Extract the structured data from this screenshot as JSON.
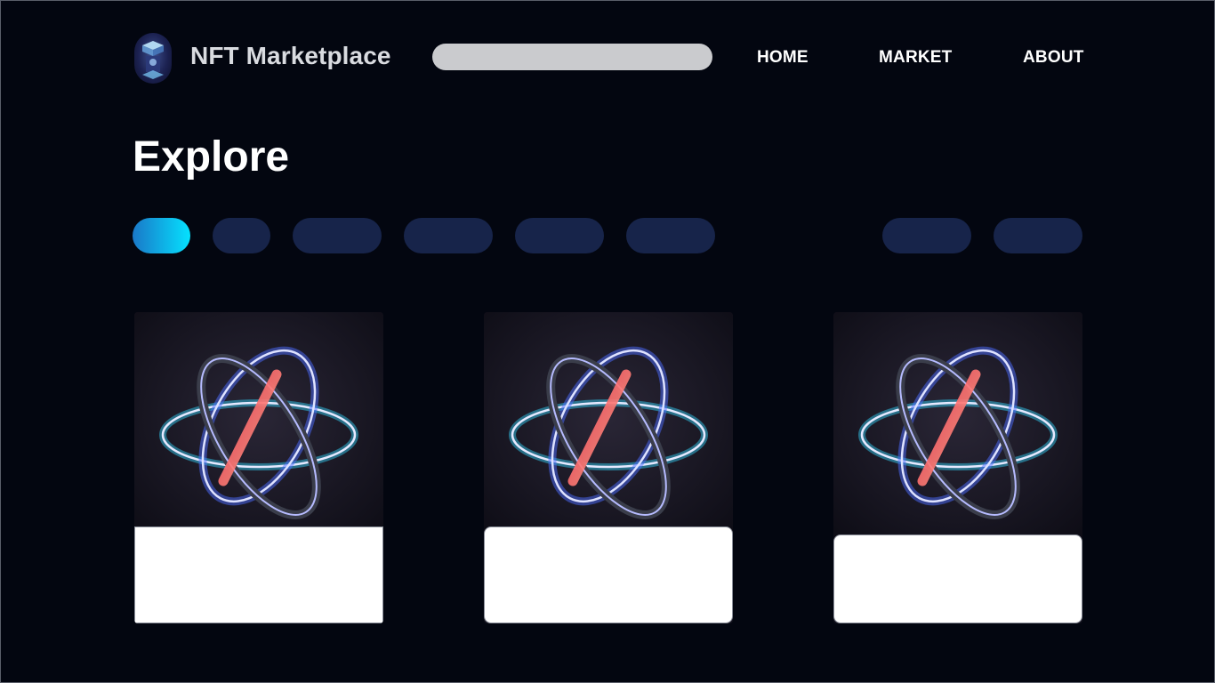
{
  "header": {
    "brand": "NFT Marketplace",
    "logo_icon": "holographic-cube-icon",
    "search": {
      "value": "",
      "placeholder": ""
    },
    "nav": [
      {
        "label": "HOME"
      },
      {
        "label": "MARKET"
      },
      {
        "label": "ABOUT"
      }
    ]
  },
  "main": {
    "title": "Explore",
    "filter_pills": [
      {
        "label": "",
        "active": true,
        "color": "#05e2ff"
      },
      {
        "label": "",
        "active": false
      },
      {
        "label": "",
        "active": false
      },
      {
        "label": "",
        "active": false
      },
      {
        "label": "",
        "active": false
      },
      {
        "label": "",
        "active": false
      }
    ],
    "sort_pills": [
      {
        "label": "",
        "active": false
      },
      {
        "label": "",
        "active": false
      }
    ],
    "cards": [
      {
        "art": "glowing-orbital-rings-artwork",
        "title": "",
        "price": ""
      },
      {
        "art": "glowing-orbital-rings-artwork",
        "title": "",
        "price": ""
      },
      {
        "art": "glowing-orbital-rings-artwork",
        "title": "",
        "price": ""
      }
    ]
  },
  "colors": {
    "background": "#030610",
    "pill": "#17244a",
    "accent": "#05e2ff",
    "search_bar": "#cacbce"
  }
}
